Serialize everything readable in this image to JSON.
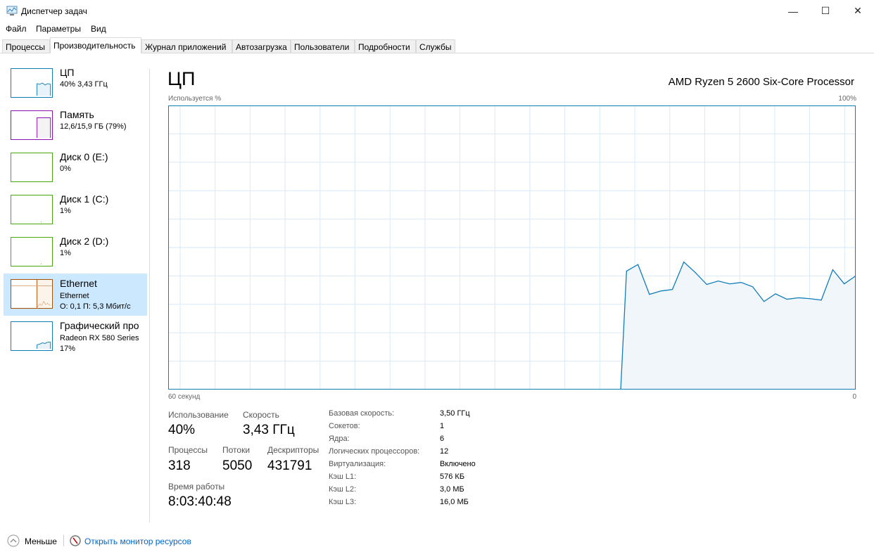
{
  "window": {
    "title": "Диспетчер задач",
    "icon": "task-manager-icon"
  },
  "menu": [
    "Файл",
    "Параметры",
    "Вид"
  ],
  "tabs": [
    "Процессы",
    "Производительность",
    "Журнал приложений",
    "Автозагрузка",
    "Пользователи",
    "Подробности",
    "Службы"
  ],
  "active_tab": "Производительность",
  "sidebar": [
    {
      "name": "ЦП",
      "sub1": "40% 3,43 ГГц",
      "color": "#117dbb"
    },
    {
      "name": "Память",
      "sub1": "12,6/15,9 ГБ (79%)",
      "color": "#8b12ae"
    },
    {
      "name": "Диск 0 (E:)",
      "sub1": "0%",
      "color": "#4da60c"
    },
    {
      "name": "Диск 1 (C:)",
      "sub1": "1%",
      "color": "#4da60c"
    },
    {
      "name": "Диск 2 (D:)",
      "sub1": "1%",
      "color": "#4da60c"
    },
    {
      "name": "Ethernet",
      "sub1": "Ethernet",
      "sub2": "О: 0,1 П: 5,3 Мбит/с",
      "color": "#a74f01",
      "selected": true
    },
    {
      "name": "Графический про",
      "sub1": "Radeon RX 580 Series",
      "sub2": "17%",
      "color": "#117dbb"
    }
  ],
  "main": {
    "title": "ЦП",
    "processor": "AMD Ryzen 5 2600 Six-Core Processor",
    "chart_top_left": "Используется %",
    "chart_top_right": "100%",
    "chart_bottom_left": "60 секунд",
    "chart_bottom_right": "0",
    "stats": {
      "usage_label": "Использование",
      "usage": "40%",
      "speed_label": "Скорость",
      "speed": "3,43 ГГц",
      "proc_label": "Процессы",
      "proc": "318",
      "threads_label": "Потоки",
      "threads": "5050",
      "handles_label": "Дескрипторы",
      "handles": "431791",
      "uptime_label": "Время работы",
      "uptime": "8:03:40:48"
    },
    "specs": [
      {
        "k": "Базовая скорость:",
        "v": "3,50 ГГц"
      },
      {
        "k": "Сокетов:",
        "v": "1"
      },
      {
        "k": "Ядра:",
        "v": "6"
      },
      {
        "k": "Логических процессоров:",
        "v": "12"
      },
      {
        "k": "Виртуализация:",
        "v": "Включено"
      },
      {
        "k": "Кэш L1:",
        "v": "576 КБ"
      },
      {
        "k": "Кэш L2:",
        "v": "3,0 МБ"
      },
      {
        "k": "Кэш L3:",
        "v": "16,0 МБ"
      }
    ]
  },
  "chart_data": {
    "type": "area",
    "xlabel": "60 секунд",
    "ylabel": "Используется %",
    "xlim": [
      60,
      0
    ],
    "ylim": [
      0,
      100
    ],
    "grid": true,
    "color": "#117dbb",
    "x_seconds_ago": [
      21,
      20,
      19,
      18,
      17,
      16,
      15,
      14,
      13,
      12,
      11,
      10,
      9,
      8,
      7,
      6,
      5,
      4,
      3,
      2,
      1,
      0
    ],
    "values": [
      0,
      41.7,
      44,
      33.5,
      34.7,
      35.2,
      44.9,
      41.2,
      37,
      38.2,
      37.2,
      37.7,
      36.2,
      31,
      33.7,
      31.8,
      32.3,
      32,
      31.5,
      42.2,
      37.2,
      40
    ]
  },
  "footer": {
    "less": "Меньше",
    "monitor": "Открыть монитор ресурсов"
  }
}
